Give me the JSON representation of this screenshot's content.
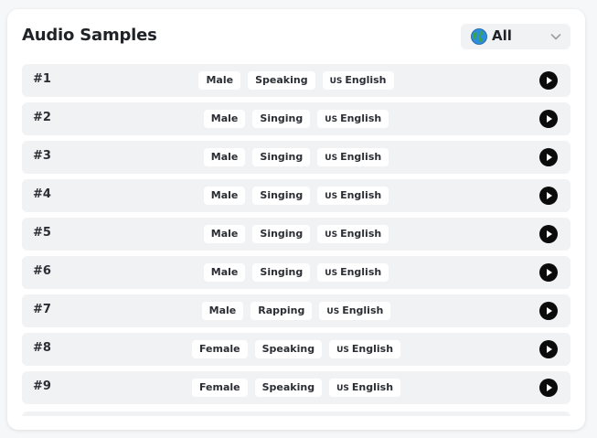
{
  "header": {
    "title": "Audio Samples",
    "filter": {
      "icon": "globe-icon",
      "label": "All"
    }
  },
  "samples": [
    {
      "num": "#1",
      "gender": "Male",
      "style": "Speaking",
      "flag": "US",
      "language": "English"
    },
    {
      "num": "#2",
      "gender": "Male",
      "style": "Singing",
      "flag": "US",
      "language": "English"
    },
    {
      "num": "#3",
      "gender": "Male",
      "style": "Singing",
      "flag": "US",
      "language": "English"
    },
    {
      "num": "#4",
      "gender": "Male",
      "style": "Singing",
      "flag": "US",
      "language": "English"
    },
    {
      "num": "#5",
      "gender": "Male",
      "style": "Singing",
      "flag": "US",
      "language": "English"
    },
    {
      "num": "#6",
      "gender": "Male",
      "style": "Singing",
      "flag": "US",
      "language": "English"
    },
    {
      "num": "#7",
      "gender": "Male",
      "style": "Rapping",
      "flag": "US",
      "language": "English"
    },
    {
      "num": "#8",
      "gender": "Female",
      "style": "Speaking",
      "flag": "US",
      "language": "English"
    },
    {
      "num": "#9",
      "gender": "Female",
      "style": "Speaking",
      "flag": "US",
      "language": "English"
    }
  ],
  "colors": {
    "row_bg": "#f1f2f4",
    "tag_bg": "#ffffff",
    "play_button": "#0b0b0b",
    "text": "#1f2328"
  },
  "icons": {
    "play": "play-icon",
    "dropdown": "chevron-down-icon"
  }
}
